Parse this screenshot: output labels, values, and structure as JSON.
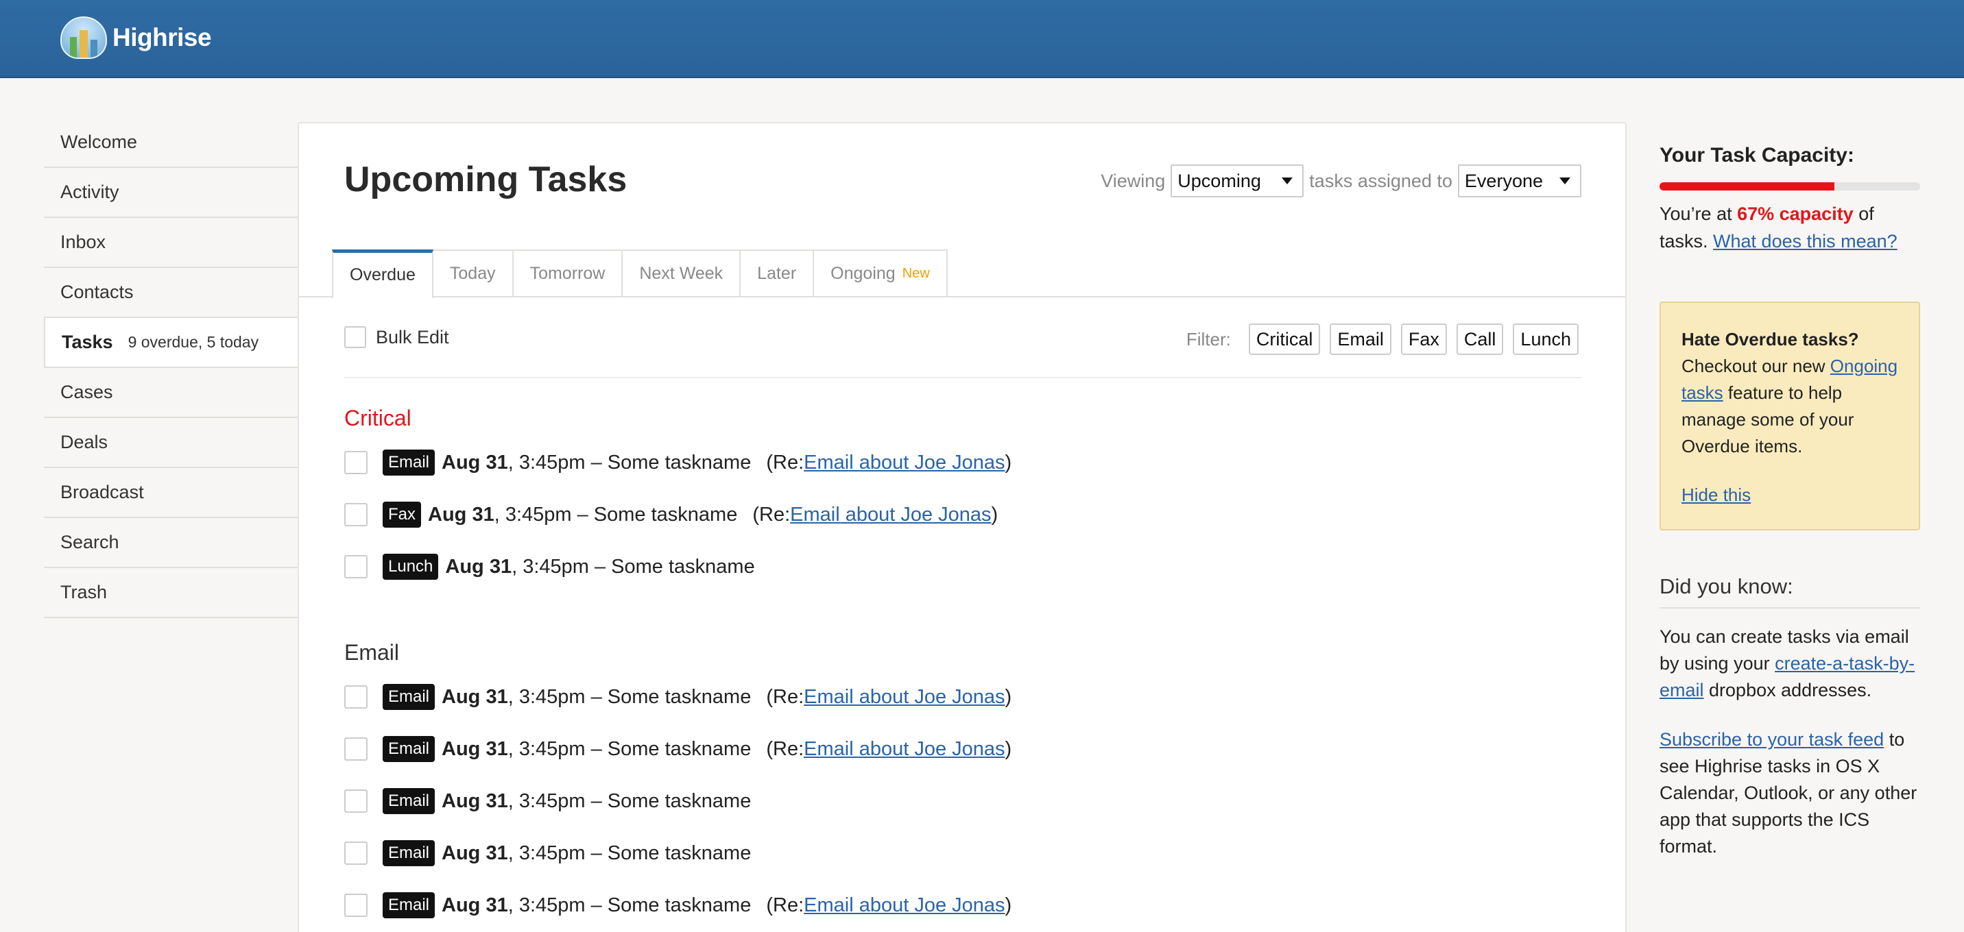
{
  "header": {
    "app_name": "Highrise",
    "brand_color": "#2f6ca3"
  },
  "sidebar": {
    "items": [
      {
        "label": "Welcome"
      },
      {
        "label": "Activity"
      },
      {
        "label": "Inbox"
      },
      {
        "label": "Contacts"
      },
      {
        "label": "Tasks",
        "sub": "9 overdue, 5 today",
        "active": true
      },
      {
        "label": "Cases"
      },
      {
        "label": "Deals"
      },
      {
        "label": "Broadcast"
      },
      {
        "label": "Search"
      },
      {
        "label": "Trash"
      }
    ]
  },
  "main": {
    "title": "Upcoming Tasks",
    "viewing_label": "Viewing",
    "viewing_value": "Upcoming",
    "assigned_label": "tasks assigned to",
    "assigned_value": "Everyone",
    "tabs": [
      {
        "label": "Overdue",
        "active": true
      },
      {
        "label": "Today"
      },
      {
        "label": "Tomorrow"
      },
      {
        "label": "Next Week"
      },
      {
        "label": "Later"
      },
      {
        "label": "Ongoing",
        "badge": "New"
      }
    ],
    "bulk_edit": "Bulk Edit",
    "filter_label": "Filter:",
    "filters": [
      "Critical",
      "Email",
      "Fax",
      "Call",
      "Lunch"
    ],
    "groups": [
      {
        "title": "Critical",
        "tasks": [
          {
            "tag": "Email",
            "date": "Aug 31",
            "text": ", 3:45pm – Some taskname",
            "re_prefix": "(Re: ",
            "re_link": "Email about Joe Jonas",
            "re_suffix": ")"
          },
          {
            "tag": "Fax",
            "date": "Aug 31",
            "text": ", 3:45pm – Some taskname",
            "re_prefix": "(Re: ",
            "re_link": "Email about Joe Jonas",
            "re_suffix": ")"
          },
          {
            "tag": "Lunch",
            "date": "Aug 31",
            "text": ", 3:45pm – Some taskname"
          }
        ]
      },
      {
        "title": "Email",
        "tasks": [
          {
            "tag": "Email",
            "date": "Aug 31",
            "text": ", 3:45pm – Some taskname",
            "re_prefix": "(Re: ",
            "re_link": "Email about Joe Jonas",
            "re_suffix": ")"
          },
          {
            "tag": "Email",
            "date": "Aug 31",
            "text": ", 3:45pm – Some taskname",
            "re_prefix": "(Re: ",
            "re_link": "Email about Joe Jonas",
            "re_suffix": ")"
          },
          {
            "tag": "Email",
            "date": "Aug 31",
            "text": ", 3:45pm – Some taskname"
          },
          {
            "tag": "Email",
            "date": "Aug 31",
            "text": ", 3:45pm – Some taskname"
          },
          {
            "tag": "Email",
            "date": "Aug 31",
            "text": ", 3:45pm – Some taskname",
            "re_prefix": "(Re: ",
            "re_link": "Email about Joe Jonas",
            "re_suffix": ")"
          }
        ]
      }
    ]
  },
  "capacity": {
    "title": "Your Task Capacity:",
    "fraction": 0.67,
    "text_before": "You’re at ",
    "pct_text": "67% capacity",
    "text_after": " of tasks. ",
    "link": "What does this mean?",
    "fill_color": "#e8131a"
  },
  "tip": {
    "title": "Hate Overdue tasks?",
    "line1": " Checkout our new ",
    "link": "Ongoing tasks",
    "line2": " feature to help manage some of your Overdue items.",
    "hide": "Hide this"
  },
  "did_you_know": {
    "title": "Did you know:",
    "p1_before": "You can create tasks via email by using your ",
    "p1_link": "create-a-task-by-email",
    "p1_after": " dropbox addresses.",
    "p2_link": "Subscribe to your task feed",
    "p2_after": " to see Highrise tasks in OS X Calendar, Outlook, or any other app that supports the ICS format."
  }
}
